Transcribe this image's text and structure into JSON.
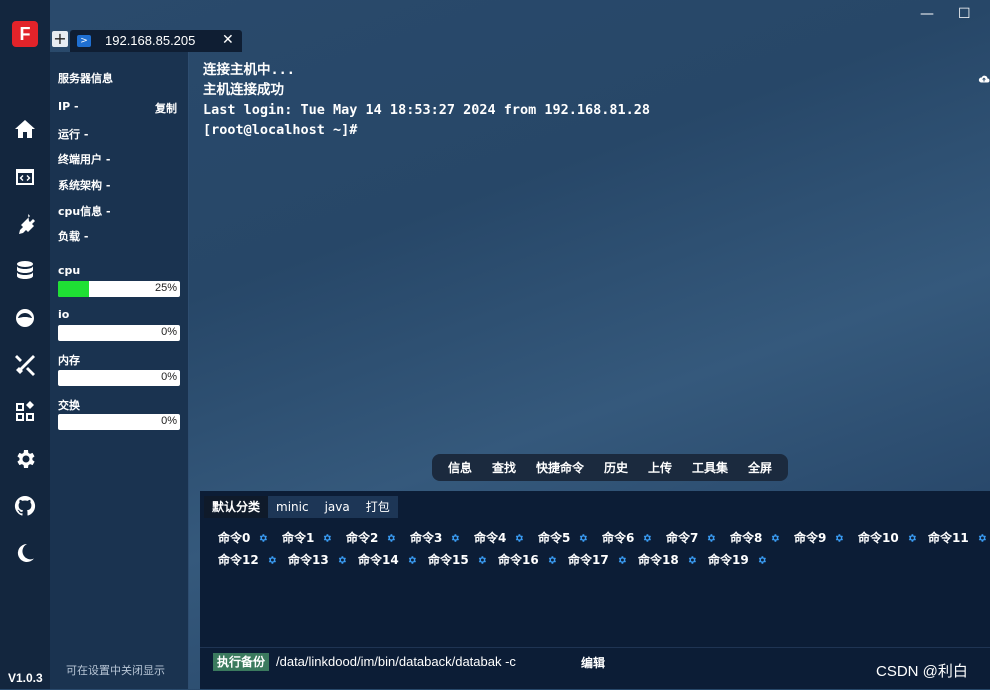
{
  "app": {
    "version": "V1.0.3",
    "logo_text": "F"
  },
  "tab": {
    "title": "192.168.85.205",
    "add_label": "+",
    "close_label": "✕"
  },
  "window_controls": {
    "minimize": "—",
    "maximize": "☐"
  },
  "info_panel": {
    "title": "服务器信息",
    "rows": [
      "IP -",
      "运行 -",
      "终端用户 -",
      "系统架构 -",
      "cpu信息 -",
      "负载 -"
    ],
    "copy_label": "复制",
    "meters": [
      {
        "label": "cpu",
        "percent": 25,
        "percent_text": "25%"
      },
      {
        "label": "io",
        "percent": 0,
        "percent_text": "0%"
      },
      {
        "label": "内存",
        "percent": 0,
        "percent_text": "0%"
      },
      {
        "label": "交换",
        "percent": 0,
        "percent_text": "0%"
      }
    ],
    "hint": "可在设置中关闭显示"
  },
  "terminal": {
    "lines": [
      "连接主机中...",
      "主机连接成功",
      "Last login: Tue May 14 18:53:27 2024 from 192.168.81.28",
      "[root@localhost ~]#"
    ]
  },
  "toolbar": {
    "items": [
      "信息",
      "查找",
      "快捷命令",
      "历史",
      "上传",
      "工具集",
      "全屏"
    ]
  },
  "command_panel": {
    "tabs": [
      "默认分类",
      "minic",
      "java",
      "打包"
    ],
    "active_tab": "默认分类",
    "commands": [
      "命令0",
      "命令1",
      "命令2",
      "命令3",
      "命令4",
      "命令5",
      "命令6",
      "命令7",
      "命令8",
      "命令9",
      "命令10",
      "命令11",
      "命令12",
      "命令13",
      "命令14",
      "命令15",
      "命令16",
      "命令17",
      "命令18",
      "命令19"
    ],
    "run_label": "执行备份",
    "run_path": "/data/linkdood/im/bin/databack/databak -c",
    "edit_label": "编辑"
  },
  "watermark": "CSDN @利白",
  "colors": {
    "accent_green": "#1fe034",
    "gear_blue": "#3a9df5",
    "logo_red": "#e2232a"
  },
  "icons": [
    "home-icon",
    "code-icon",
    "plug-icon",
    "database-icon",
    "docker-icon",
    "tools-icon",
    "apps-icon",
    "settings-icon",
    "github-icon",
    "moon-icon"
  ]
}
